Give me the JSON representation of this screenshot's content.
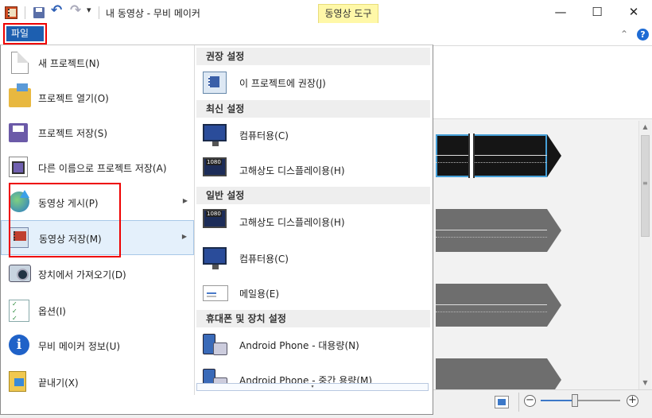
{
  "titlebar": {
    "title": "내 동영상 - 무비 메이커",
    "context_tab": "동영상 도구",
    "undo_glyph": "↶",
    "redo_glyph": "↷",
    "qa_dropdown_glyph": "▾",
    "minimize_glyph": "—",
    "maximize_glyph": "☐",
    "close_glyph": "✕"
  },
  "ribbon": {
    "file_tab": "파일",
    "collapse_glyph": "⌃",
    "help_glyph": "?"
  },
  "menu": {
    "items": [
      {
        "label": "새 프로젝트(N)",
        "icon": "new-document-icon"
      },
      {
        "label": "프로젝트 열기(O)",
        "icon": "open-folder-icon"
      },
      {
        "label": "프로젝트 저장(S)",
        "icon": "save-icon"
      },
      {
        "label": "다른 이름으로 프로젝트 저장(A)",
        "icon": "save-as-icon"
      },
      {
        "label": "동영상 게시(P)",
        "icon": "publish-globe-icon"
      },
      {
        "label": "동영상 저장(M)",
        "icon": "save-movie-icon"
      },
      {
        "label": "장치에서 가져오기(D)",
        "icon": "camera-import-icon"
      },
      {
        "label": "옵션(I)",
        "icon": "options-checklist-icon"
      },
      {
        "label": "무비 메이커 정보(U)",
        "icon": "info-icon"
      },
      {
        "label": "끝내기(X)",
        "icon": "exit-icon"
      }
    ],
    "submenu_arrow": "▶"
  },
  "submenu": {
    "sections": [
      {
        "header": "권장 설정",
        "items": [
          {
            "label": "이 프로젝트에 권장(J)",
            "icon": "recommended-settings-icon"
          }
        ]
      },
      {
        "header": "최신 설정",
        "items": [
          {
            "label": "컴퓨터용(C)",
            "icon": "computer-monitor-icon"
          },
          {
            "label": "고해상도 디스플레이용(H)",
            "icon": "hd-display-icon"
          }
        ]
      },
      {
        "header": "일반 설정",
        "items": [
          {
            "label": "고해상도 디스플레이용(H)",
            "icon": "hd-display-icon"
          },
          {
            "label": "컴퓨터용(C)",
            "icon": "computer-monitor-icon"
          },
          {
            "label": "메일용(E)",
            "icon": "email-icon"
          }
        ]
      },
      {
        "header": "휴대폰 및 장치 설정",
        "items": [
          {
            "label": "Android Phone - 대용량(N)",
            "icon": "android-phone-icon"
          },
          {
            "label": "Android Phone - 중간 용량(M)",
            "icon": "android-phone-icon"
          }
        ]
      }
    ],
    "scroll_glyph": "▾"
  },
  "scrollbar": {
    "up": "▲",
    "grip": "≡",
    "down": "▼"
  },
  "statusbar": {
    "zoom_out": "−",
    "zoom_in": "+",
    "zoom_level": 0.42
  },
  "colors": {
    "file_tab": "#1d5fb0",
    "context_tab": "#fff8a8",
    "highlight_box": "#ee0000",
    "active_item": "#e4f0fb"
  }
}
